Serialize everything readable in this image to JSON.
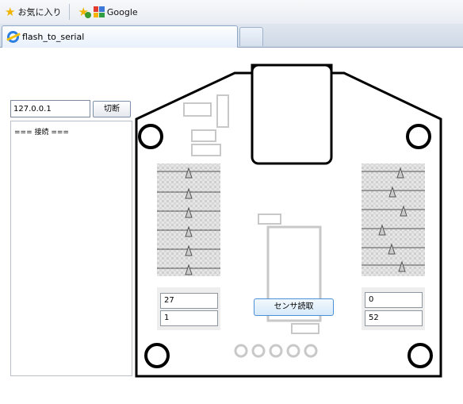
{
  "browser": {
    "favorites_label": "お気に入り",
    "google_label": "Google",
    "tab_title": "flash_to_serial"
  },
  "controls": {
    "ip_value": "127.0.0.1",
    "disconnect_label": "切断",
    "log_text": "=== 接続 ===",
    "sensor_button_label": "センサ読取"
  },
  "sensors": {
    "left_top": "27",
    "left_bottom": "1",
    "right_top": "0",
    "right_bottom": "52"
  },
  "colors": {
    "favorites_star": "#f0b400",
    "board_outline": "#000000",
    "button_border": "#4a90d9"
  }
}
